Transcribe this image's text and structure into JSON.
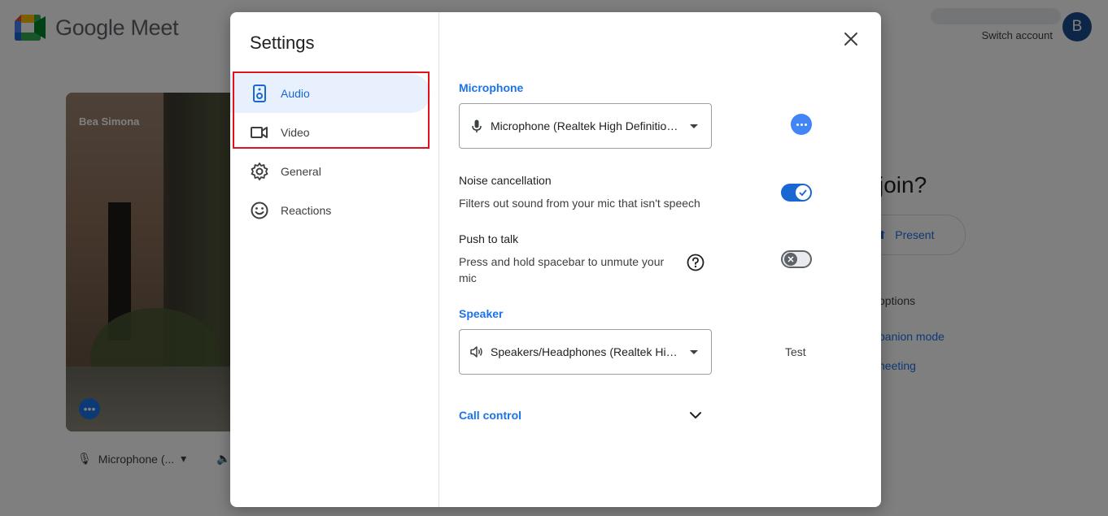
{
  "app": {
    "title": "Google Meet",
    "switch_account": "Switch account",
    "avatar_letter": "B"
  },
  "preview": {
    "name": "Bea Simona",
    "mic_label": "Microphone (..."
  },
  "join_page": {
    "join_question": "join?",
    "present_label": "Present",
    "other_options": "options",
    "companion_mode": "panion mode",
    "other_meeting": "neeting"
  },
  "settings": {
    "title": "Settings",
    "nav": [
      {
        "label": "Audio",
        "icon": "speaker-icon",
        "active": true
      },
      {
        "label": "Video",
        "icon": "video-camera-icon",
        "active": false
      },
      {
        "label": "General",
        "icon": "gear-icon",
        "active": false
      },
      {
        "label": "Reactions",
        "icon": "smiley-icon",
        "active": false
      }
    ],
    "microphone": {
      "section_label": "Microphone",
      "selected": "Microphone (Realtek High Definition Audio)"
    },
    "noise_cancellation": {
      "label": "Noise cancellation",
      "description": "Filters out sound from your mic that isn't speech",
      "enabled": true
    },
    "push_to_talk": {
      "label": "Push to talk",
      "description_line1": "Press and hold spacebar to unmute your",
      "description_line2": "mic",
      "enabled": false
    },
    "speaker": {
      "section_label": "Speaker",
      "selected": "Speakers/Headphones (Realtek High Definition Audio)",
      "test_label": "Test"
    },
    "call_control": {
      "section_label": "Call control"
    }
  },
  "colors": {
    "accent": "#1a73e8",
    "active_bg": "#e8f0fe",
    "highlight_box": "#e0121e"
  }
}
